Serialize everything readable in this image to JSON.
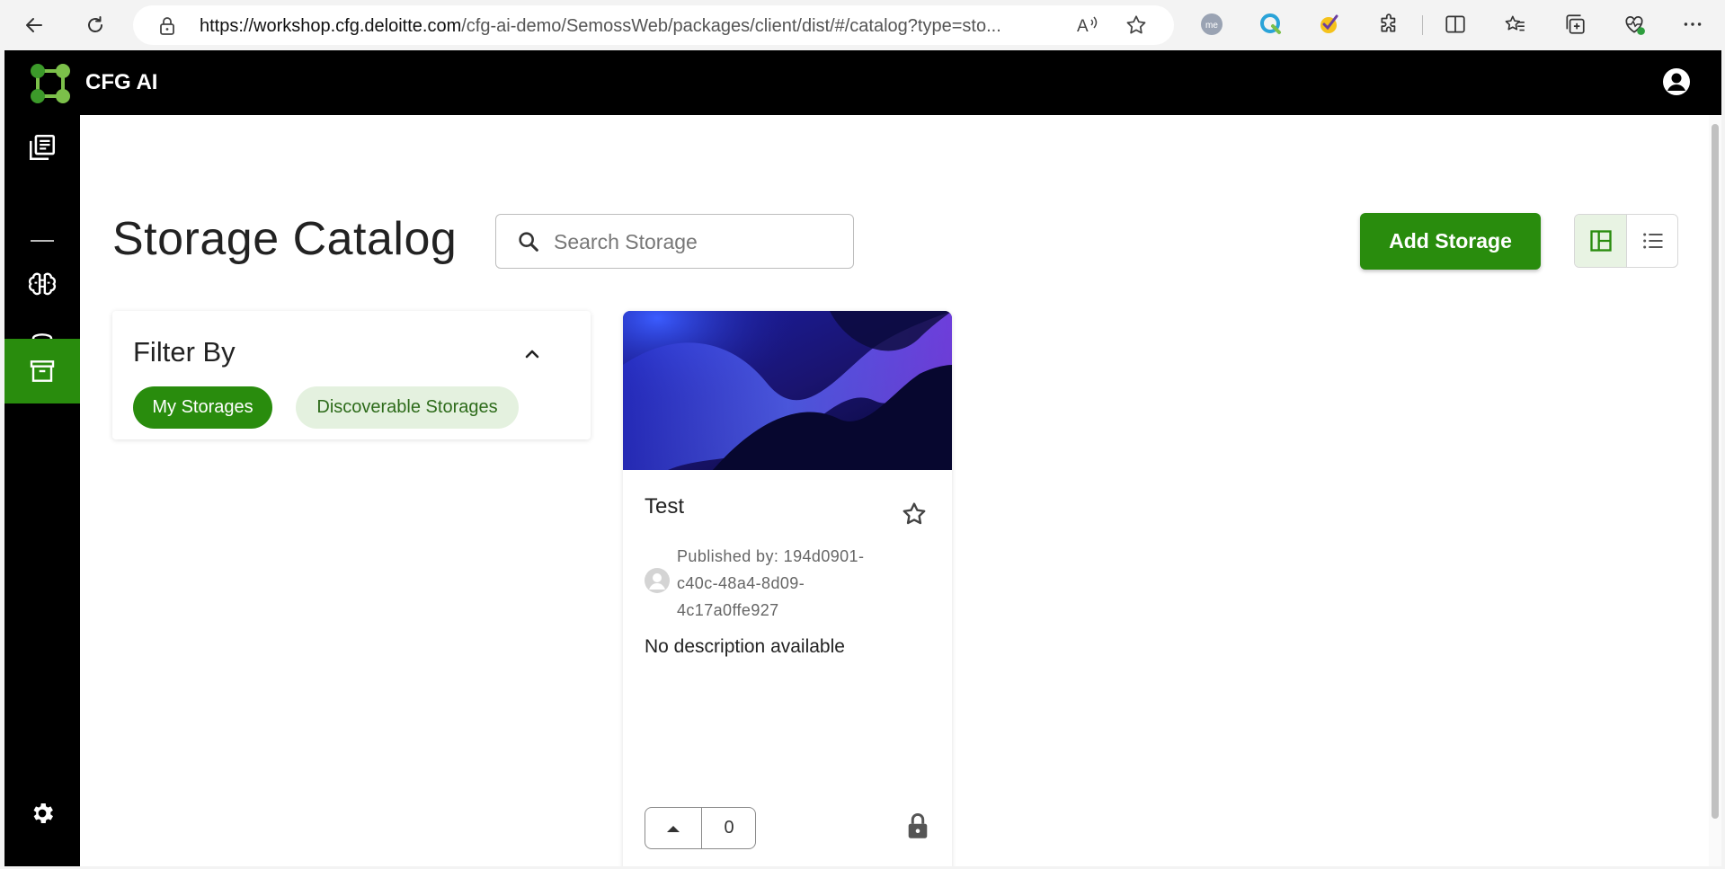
{
  "browser": {
    "url_host": "https://workshop.cfg.deloitte.com",
    "url_path": "/cfg-ai-demo/SemossWeb/packages/client/dist/#/catalog?type=sto...",
    "read_aloud": "Aᵀ"
  },
  "app": {
    "name": "CFG AI"
  },
  "page": {
    "title": "Storage Catalog",
    "search_placeholder": "Search Storage",
    "add_button": "Add Storage"
  },
  "filter": {
    "title": "Filter By",
    "chips": [
      "My Storages",
      "Discoverable Storages"
    ]
  },
  "card": {
    "title": "Test",
    "published_by": "Published by: 194d0901-c40c-48a4-8d09-4c17a0ffe927",
    "description": "No description available",
    "votes": "0"
  },
  "colors": {
    "brand_green": "#298c0d",
    "topbar": "#000000"
  }
}
